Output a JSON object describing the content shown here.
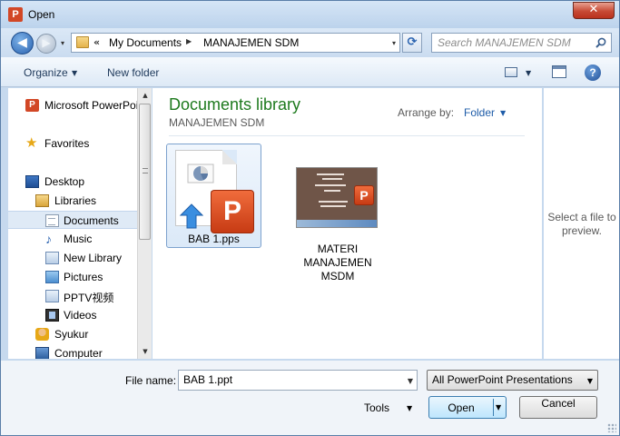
{
  "window": {
    "title": "Open",
    "app_icon_letter": "P",
    "close_glyph": "✕"
  },
  "nav": {
    "back_glyph": "◀",
    "forward_glyph": "▶",
    "history_glyph": "▾"
  },
  "address": {
    "chevron": "«",
    "crumbs": [
      "My Documents",
      "MANAJEMEN SDM"
    ],
    "separator_glyph": "▶",
    "dropdown_glyph": "▾",
    "refresh_glyph": "⟳"
  },
  "search": {
    "placeholder": "Search MANAJEMEN SDM"
  },
  "toolbar": {
    "organize": "Organize",
    "organize_arrow": "▼",
    "new_folder": "New folder",
    "view_arrow": "▼",
    "help_glyph": "?"
  },
  "sidebar": {
    "items": [
      {
        "label": "Microsoft PowerPoint",
        "icon": "powerpoint-icon",
        "glyph": "P"
      },
      {
        "label": "Favorites",
        "icon": "star-icon",
        "glyph": "★"
      },
      {
        "label": "Desktop",
        "icon": "desktop-icon"
      },
      {
        "label": "Libraries",
        "icon": "libraries-icon"
      },
      {
        "label": "Documents",
        "icon": "documents-icon",
        "selected": true
      },
      {
        "label": "Music",
        "icon": "music-icon",
        "glyph": "♪"
      },
      {
        "label": "New Library",
        "icon": "library-icon"
      },
      {
        "label": "Pictures",
        "icon": "pictures-icon"
      },
      {
        "label": "PPTV视频",
        "icon": "library-icon"
      },
      {
        "label": "Videos",
        "icon": "videos-icon"
      },
      {
        "label": "Syukur",
        "icon": "user-folder-icon"
      },
      {
        "label": "Computer",
        "icon": "computer-icon"
      }
    ],
    "scroll_up_glyph": "▲",
    "scroll_down_glyph": "▼"
  },
  "content": {
    "library_title": "Documents library",
    "library_subtitle": "MANAJEMEN SDM",
    "arrange_label": "Arrange by:",
    "arrange_value": "Folder",
    "arrange_arrow": "▼",
    "files": [
      {
        "name": "BAB 1.pps",
        "type": "pps",
        "selected": true,
        "badge_letter": "P"
      },
      {
        "name": "MATERI\nMANAJEMEN\nMSDM",
        "type": "ppt-thumbnail",
        "selected": false,
        "badge_letter": "P"
      }
    ]
  },
  "preview": {
    "text": "Select a file to preview."
  },
  "footer": {
    "file_name_label": "File name:",
    "file_name_value": "BAB 1.ppt",
    "file_name_dropdown_glyph": "▼",
    "file_type_value": "All PowerPoint Presentations",
    "file_type_dropdown_glyph": "▼",
    "tools_label": "Tools",
    "tools_arrow": "▼",
    "open_label": "Open",
    "open_arrow": "▼",
    "cancel_label": "Cancel"
  }
}
